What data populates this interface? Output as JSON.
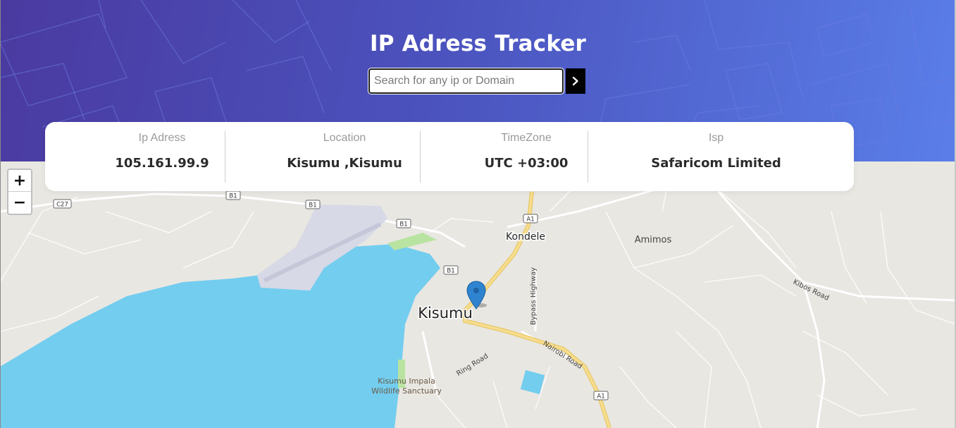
{
  "header": {
    "title": "IP Adress Tracker",
    "search_placeholder": "Search for any ip or Domain",
    "search_value": "",
    "submit_icon": "chevron-right-icon"
  },
  "info": {
    "ip": {
      "label": "Ip Adress",
      "value": "105.161.99.9"
    },
    "location": {
      "label": "Location",
      "value": "Kisumu ,Kisumu"
    },
    "timezone": {
      "label": "TimeZone",
      "value": "UTC +03:00"
    },
    "isp": {
      "label": "Isp",
      "value": "Safaricom Limited"
    }
  },
  "map": {
    "zoom_in": "+",
    "zoom_out": "−",
    "marker_icon": "map-pin-icon",
    "labels": {
      "city": "Kisumu",
      "kondele": "Kondele",
      "amimos": "Amimos",
      "kibos_road": "Kibos Road",
      "nairobi_road": "Nairobi Road",
      "bypass_highway": "Bypass Highway",
      "ring_road": "Ring Road",
      "sanctuary_line1": "Kisumu Impala",
      "sanctuary_line2": "Wildlife Sanctuary"
    },
    "shields": {
      "c27": "C27",
      "b1": "B1",
      "a1": "A1"
    },
    "colors": {
      "water": "#73cdef",
      "land": "#e9e7e2",
      "major_road": "#f2d27a",
      "airport": "#d7d9e6",
      "park": "#b9e3a1"
    }
  },
  "colors": {
    "header_start": "#4a3aa0",
    "header_end": "#5a7ee8",
    "card_bg": "#ffffff",
    "button_bg": "#000000"
  }
}
